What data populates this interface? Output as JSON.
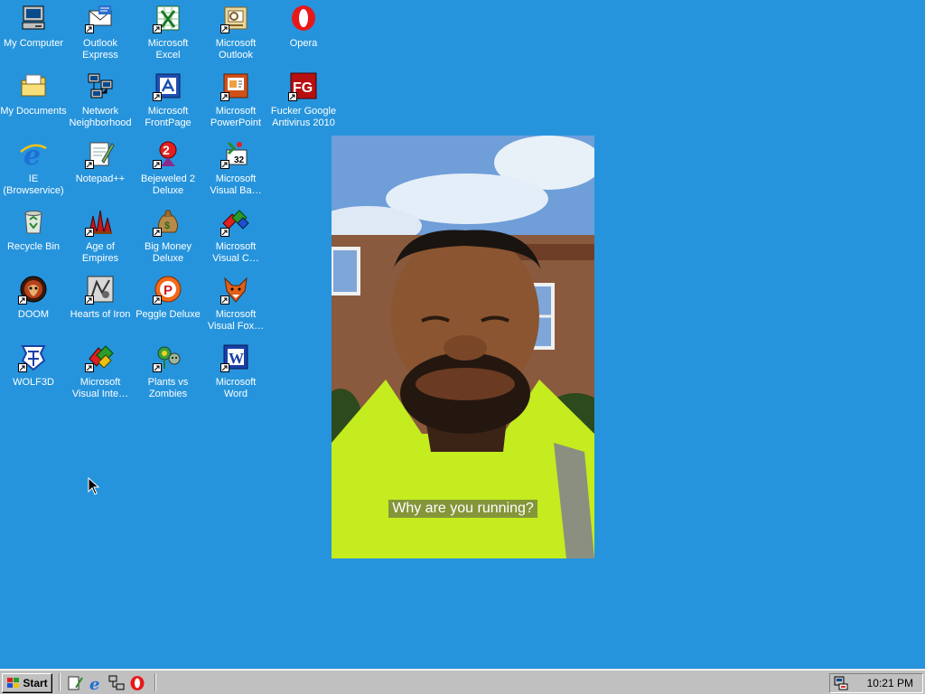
{
  "desktop": {
    "background_color": "#2694dc",
    "icons": [
      {
        "label": "My Computer",
        "icon": "computer-icon"
      },
      {
        "label": "Outlook\nExpress",
        "icon": "outlook-express-icon"
      },
      {
        "label": "Microsoft\nExcel",
        "icon": "excel-icon"
      },
      {
        "label": "Microsoft\nOutlook",
        "icon": "outlook-icon"
      },
      {
        "label": "Opera",
        "icon": "opera-icon"
      },
      {
        "label": "My Documents",
        "icon": "folder-icon"
      },
      {
        "label": "Network\nNeighborhood",
        "icon": "network-icon"
      },
      {
        "label": "Microsoft\nFrontPage",
        "icon": "frontpage-icon"
      },
      {
        "label": "Microsoft\nPowerPoint",
        "icon": "powerpoint-icon"
      },
      {
        "label": "Fucker Google\nAntivirus 2010",
        "icon": "antivirus-icon"
      },
      {
        "label": "IE\n(Browservice)",
        "icon": "internet-explorer-icon"
      },
      {
        "label": "Notepad++",
        "icon": "notepad-icon"
      },
      {
        "label": "Bejeweled 2\nDeluxe",
        "icon": "bejeweled-icon"
      },
      {
        "label": "Microsoft\nVisual Ba…",
        "icon": "visual-basic-icon"
      },
      {
        "label": "Recycle Bin",
        "icon": "recycle-bin-icon"
      },
      {
        "label": "Age of\nEmpires",
        "icon": "age-of-empires-icon"
      },
      {
        "label": "Big Money\nDeluxe",
        "icon": "money-bag-icon"
      },
      {
        "label": "Microsoft\nVisual C…",
        "icon": "visual-c-icon"
      },
      {
        "label": "DOOM",
        "icon": "doom-icon"
      },
      {
        "label": "Hearts of Iron",
        "icon": "hearts-of-iron-icon"
      },
      {
        "label": "Peggle Deluxe",
        "icon": "peggle-icon"
      },
      {
        "label": "Microsoft\nVisual Fox…",
        "icon": "visual-foxpro-icon"
      },
      {
        "label": "WOLF3D",
        "icon": "wolf3d-icon"
      },
      {
        "label": "Microsoft\nVisual Inte…",
        "icon": "visual-interdev-icon"
      },
      {
        "label": "Plants vs\nZombies",
        "icon": "plants-vs-zombies-icon"
      },
      {
        "label": "Microsoft\nWord",
        "icon": "word-icon"
      }
    ]
  },
  "photo": {
    "caption": "Why are you running?"
  },
  "taskbar": {
    "start_label": "Start",
    "quick_launch": [
      "notepad-icon",
      "internet-explorer-icon",
      "network-icon",
      "opera-icon"
    ],
    "clock": "10:21 PM"
  }
}
